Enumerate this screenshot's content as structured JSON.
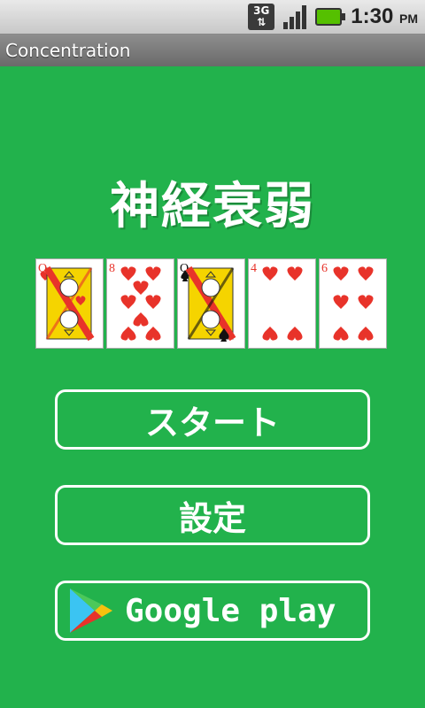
{
  "status": {
    "network": "3G",
    "time": "1:30",
    "ampm": "PM"
  },
  "app": {
    "title": "Concentration"
  },
  "main": {
    "heading": "神経衰弱",
    "cards": [
      {
        "rank": "Q",
        "suit": "hearts",
        "suit_color": "#e8332a"
      },
      {
        "rank": "8",
        "suit": "hearts",
        "suit_color": "#e8332a"
      },
      {
        "rank": "Q",
        "suit": "spades",
        "suit_color": "#111111"
      },
      {
        "rank": "4",
        "suit": "hearts",
        "suit_color": "#e8332a"
      },
      {
        "rank": "6",
        "suit": "hearts",
        "suit_color": "#e8332a"
      }
    ],
    "start_label": "スタート",
    "settings_label": "設定",
    "gplay_label": "Google play"
  },
  "colors": {
    "background": "#22b24c",
    "heart": "#e8332a"
  }
}
